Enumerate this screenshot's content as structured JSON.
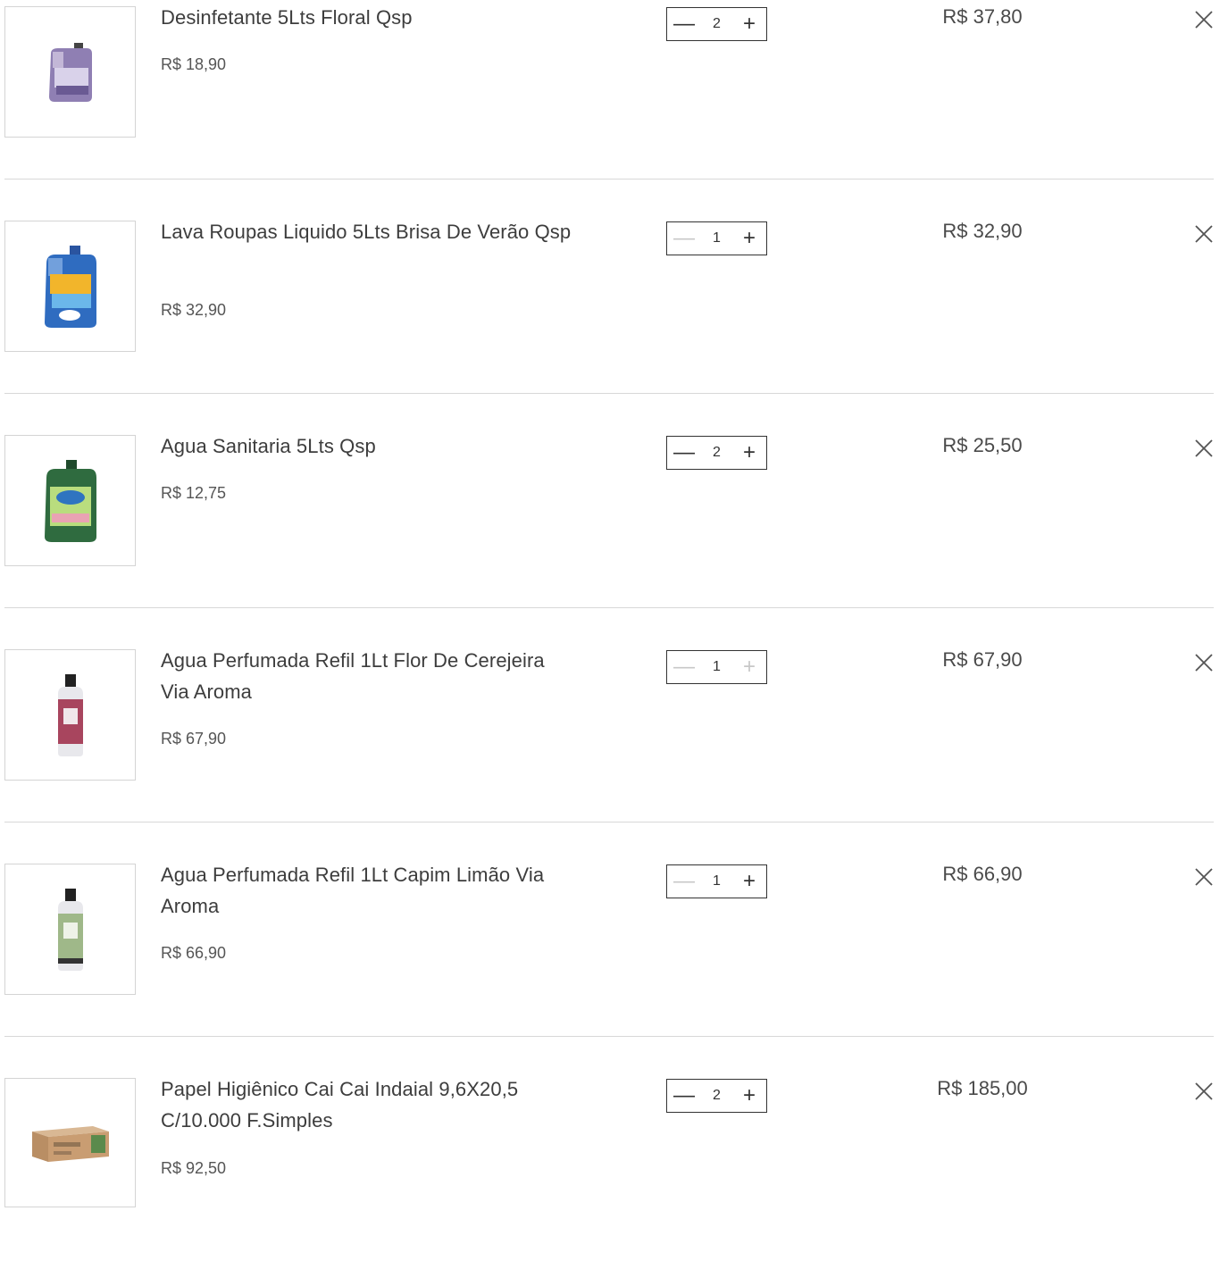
{
  "cart": {
    "items": [
      {
        "name": "Desinfetante 5Lts Floral Qsp",
        "unit_price": "R$ 18,90",
        "quantity": "2",
        "total": "R$ 37,80",
        "image": "purple-jug-icon",
        "minus_enabled": true,
        "plus_enabled": true
      },
      {
        "name": "Lava Roupas Liquido 5Lts Brisa De Verão Qsp",
        "unit_price": "R$ 32,90",
        "quantity": "1",
        "total": "R$ 32,90",
        "image": "blue-jug-icon",
        "minus_enabled": false,
        "plus_enabled": true
      },
      {
        "name": "Agua Sanitaria 5Lts Qsp",
        "unit_price": "R$ 12,75",
        "quantity": "2",
        "total": "R$ 25,50",
        "image": "green-jug-icon",
        "minus_enabled": true,
        "plus_enabled": true
      },
      {
        "name": "Agua Perfumada Refil 1Lt Flor De Cerejeira Via Aroma",
        "unit_price": "R$ 67,90",
        "quantity": "1",
        "total": "R$ 67,90",
        "image": "pink-bottle-icon",
        "minus_enabled": false,
        "plus_enabled": false
      },
      {
        "name": "Agua Perfumada Refil 1Lt Capim Limão Via Aroma",
        "unit_price": "R$ 66,90",
        "quantity": "1",
        "total": "R$ 66,90",
        "image": "green-bottle-icon",
        "minus_enabled": false,
        "plus_enabled": true
      },
      {
        "name": "Papel Higiênico Cai Cai Indaial 9,6X20,5 C/10.000 F.Simples",
        "unit_price": "R$ 92,50",
        "quantity": "2",
        "total": "R$ 185,00",
        "image": "paper-box-icon",
        "minus_enabled": true,
        "plus_enabled": true
      }
    ],
    "icons": {
      "decrease": "minus-icon",
      "increase": "plus-icon",
      "remove": "close-icon"
    },
    "colors": {
      "text": "#3d3d3d",
      "border": "#333333",
      "disabled": "#c8c8c8",
      "separator": "#d8d8d8"
    }
  }
}
